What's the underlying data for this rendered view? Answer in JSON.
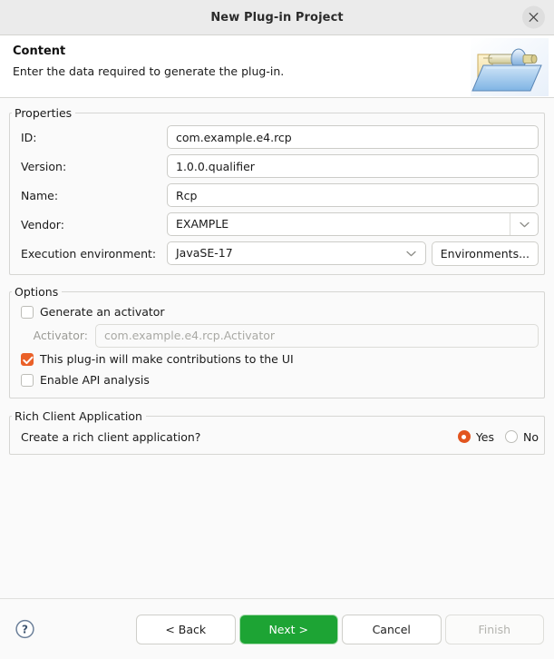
{
  "window": {
    "title": "New Plug-in Project",
    "close_icon": "close-icon"
  },
  "banner": {
    "title": "Content",
    "subtitle": "Enter the data required to generate the plug-in.",
    "icon": "plugin-folder-icon"
  },
  "properties": {
    "legend": "Properties",
    "fields": [
      {
        "label": "ID:",
        "value": "com.example.e4.rcp",
        "type": "text"
      },
      {
        "label": "Version:",
        "value": "1.0.0.qualifier",
        "type": "text"
      },
      {
        "label": "Name:",
        "value": "Rcp",
        "type": "text"
      },
      {
        "label": "Vendor:",
        "value": "EXAMPLE",
        "type": "combo"
      }
    ],
    "execution_environment": {
      "label": "Execution environment:",
      "value": "JavaSE-17",
      "button_label": "Environments..."
    }
  },
  "options": {
    "legend": "Options",
    "generate_activator": {
      "label": "Generate an activator",
      "checked": false
    },
    "activator": {
      "label": "Activator:",
      "value": "com.example.e4.rcp.Activator",
      "enabled": false
    },
    "ui_contributions": {
      "label": "This plug-in will make contributions to the UI",
      "checked": true
    },
    "api_analysis": {
      "label": "Enable API analysis",
      "checked": false
    }
  },
  "rich_client": {
    "legend": "Rich Client Application",
    "question": "Create a rich client application?",
    "options": [
      {
        "label": "Yes",
        "selected": true
      },
      {
        "label": "No",
        "selected": false
      }
    ]
  },
  "footer": {
    "help_icon": "help-icon",
    "buttons": [
      {
        "label": "< Back",
        "style": "normal"
      },
      {
        "label": "Next >",
        "style": "primary"
      },
      {
        "label": "Cancel",
        "style": "normal"
      },
      {
        "label": "Finish",
        "style": "disabled"
      }
    ]
  },
  "colors": {
    "accent_orange": "#ea6028",
    "radio_orange": "#e2551f",
    "primary_green": "#1da434",
    "titlebar_bg": "#ebebeb",
    "content_bg": "#fafafa"
  }
}
